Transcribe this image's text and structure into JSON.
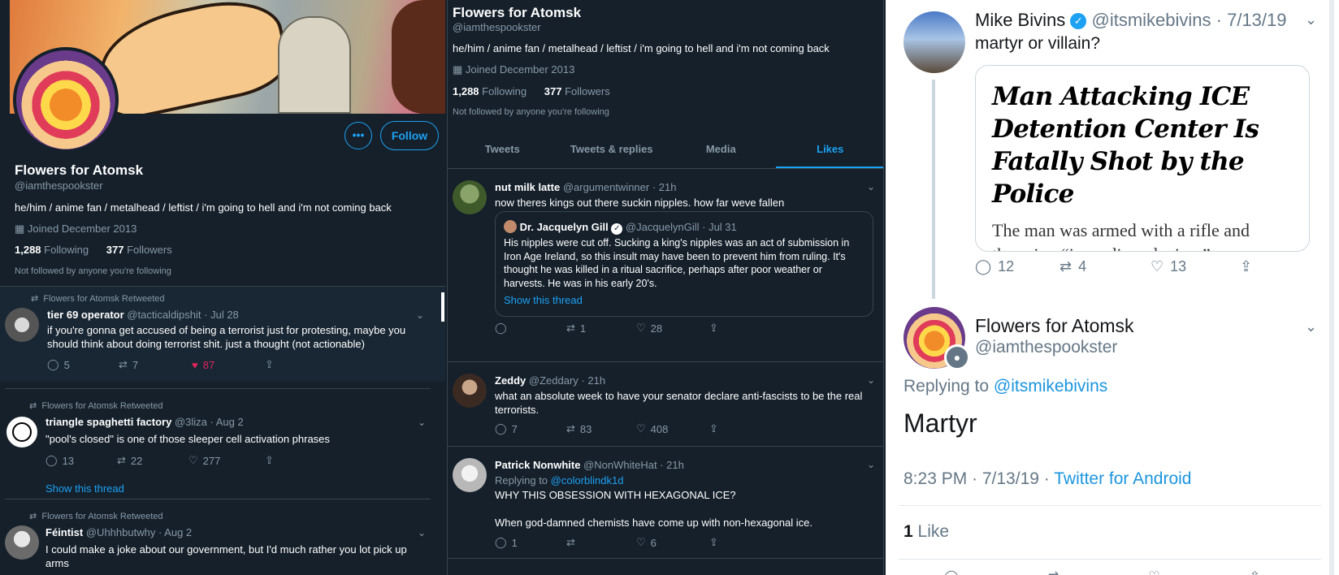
{
  "left": {
    "more_label": "•••",
    "follow_label": "Follow",
    "name": "Flowers for Atomsk",
    "handle": "@iamthespookster",
    "bio": "he/him / anime fan / metalhead / leftist / i'm going to hell and i'm not coming back",
    "joined": "Joined December 2013",
    "following_count": "1,288",
    "following_label": "Following",
    "followers_count": "377",
    "followers_label": "Followers",
    "not_followed": "Not followed by anyone you're following",
    "tweets": [
      {
        "retweet_label": "Flowers for Atomsk Retweeted",
        "name": "tier 69 operator",
        "handle": "@tacticaldipshit",
        "date": "· Jul 28",
        "text": "if you're gonna get accused of being a terrorist just for protesting, maybe you should think about doing terrorist shit. just a thought (not actionable)",
        "replies": "5",
        "retweets": "7",
        "likes": "87"
      },
      {
        "retweet_label": "Flowers for Atomsk Retweeted",
        "name": "triangle spaghetti factory",
        "handle": "@3liza",
        "date": "· Aug 2",
        "text": "\"pool's closed\" is one of those sleeper cell activation phrases",
        "replies": "13",
        "retweets": "22",
        "likes": "277",
        "show_thread": "Show this thread"
      },
      {
        "retweet_label": "Flowers for Atomsk Retweeted",
        "name": "Féintist",
        "handle": "@Uhhhbutwhy",
        "date": "· Aug 2",
        "text": "I could make a joke about our government, but I'd much rather you lot pick up arms"
      }
    ]
  },
  "mid": {
    "name": "Flowers for Atomsk",
    "handle": "@iamthespookster",
    "bio": "he/him / anime fan / metalhead / leftist / i'm going to hell and i'm not coming back",
    "joined": "Joined December 2013",
    "following_count": "1,288",
    "following_label": "Following",
    "followers_count": "377",
    "followers_label": "Followers",
    "not_followed": "Not followed by anyone you're following",
    "tabs": [
      {
        "label": "Tweets"
      },
      {
        "label": "Tweets & replies"
      },
      {
        "label": "Media"
      },
      {
        "label": "Likes"
      }
    ],
    "tweets": [
      {
        "name": "nut milk latte",
        "handle": "@argumentwinner",
        "date": "· 21h",
        "text": "now theres kings out there suckin nipples. how far weve fallen",
        "quote": {
          "name": "Dr. Jacquelyn Gill",
          "handle": "@JacquelynGill",
          "date": "· Jul 31",
          "text": "His nipples were cut off. Sucking a king's nipples was an act of submission in Iron Age Ireland, so this insult may have been to prevent him from ruling. It's thought he was killed in a ritual sacrifice, perhaps after poor weather or harvests. He was in his early 20's.",
          "show_thread": "Show this thread"
        },
        "retweets": "1",
        "likes": "28"
      },
      {
        "name": "Zeddy",
        "handle": "@Zeddary",
        "date": "· 21h",
        "text": "what an absolute week to have your senator declare anti-fascists to be the real terrorists.",
        "replies": "7",
        "retweets": "83",
        "likes": "408"
      },
      {
        "name": "Patrick Nonwhite",
        "handle": "@NonWhiteHat",
        "date": "· 21h",
        "replying_prefix": "Replying to",
        "replying_to": "@colorblindk1d",
        "text": "WHY THIS OBSESSION WITH HEXAGONAL ICE?",
        "text2": "When god-damned chemists have come up with non-hexagonal ice.",
        "replies": "1",
        "likes": "6"
      }
    ]
  },
  "right": {
    "name": "Mike Bivins",
    "verified_mark": "✓",
    "handle": "@itsmikebivins",
    "date": "· 7/13/19",
    "text": "martyr or villain?",
    "card_headline": "Man Attacking ICE Detention Center Is Fatally Shot by the Police",
    "card_subtext": "The man was armed with a rifle and throwing “incendiary devices” on Saturday in Tacoma, Wash., officials",
    "replies": "12",
    "retweets": "4",
    "likes": "13",
    "reply_name": "Flowers for Atomsk",
    "reply_handle": "@iamthespookster",
    "replying_prefix": "Replying to",
    "replying_to": "@itsmikebivins",
    "reply_text": "Martyr",
    "time": "8:23 PM · 7/13/19 ·",
    "source": "Twitter for Android",
    "like_count": "1",
    "like_label": "Like"
  },
  "colors": {
    "background": "#15202b",
    "accent": "#1da1f2",
    "like": "#e0245e",
    "muted": "#8899a6"
  }
}
